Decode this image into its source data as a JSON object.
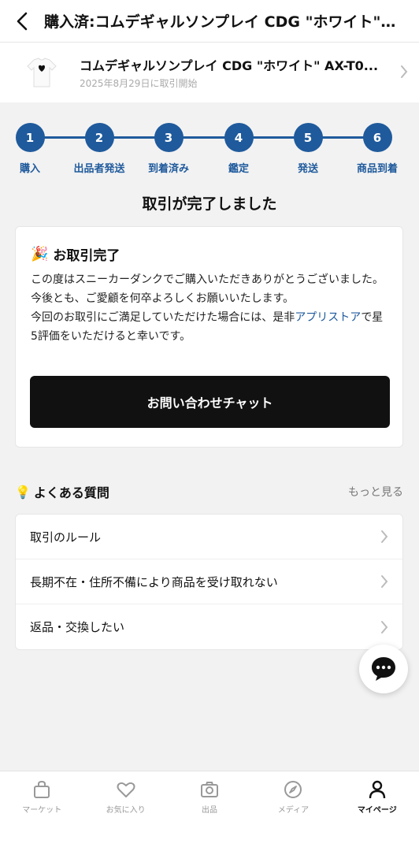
{
  "header": {
    "title": "購入済:コムデギャルソンプレイ CDG \"ホワイト\" AX-T0..."
  },
  "product": {
    "name": "コムデギャルソンプレイ CDG \"ホワイト\" AX-T0...",
    "sub": "2025年8月29日に取引開始"
  },
  "steps": [
    {
      "num": "1",
      "label": "購入"
    },
    {
      "num": "2",
      "label": "出品者発送"
    },
    {
      "num": "3",
      "label": "到着済み"
    },
    {
      "num": "4",
      "label": "鑑定"
    },
    {
      "num": "5",
      "label": "発送"
    },
    {
      "num": "6",
      "label": "商品到着"
    }
  ],
  "status_title": "取引が完了しました",
  "card": {
    "title": "お取引完了",
    "line1": "この度はスニーカーダンクでご購入いただきありがとうございました。",
    "line2": "今後とも、ご愛顧を何卒よろしくお願いいたします。",
    "line3_pre": "今回のお取引にご満足していただけた場合には、是非",
    "line3_link": "アプリストア",
    "line3_post": "で星5評価をいただけると幸いです。",
    "button": "お問い合わせチャット"
  },
  "faq": {
    "title": "よくある質問",
    "more": "もっと見る",
    "items": [
      "取引のルール",
      "長期不在・住所不備により商品を受け取れない",
      "返品・交換したい"
    ]
  },
  "nav": {
    "items": [
      {
        "label": "マーケット",
        "icon": "bag-icon"
      },
      {
        "label": "お気に入り",
        "icon": "heart-icon"
      },
      {
        "label": "出品",
        "icon": "camera-icon"
      },
      {
        "label": "メディア",
        "icon": "compass-icon"
      },
      {
        "label": "マイページ",
        "icon": "person-icon"
      }
    ],
    "active": "マイページ"
  },
  "colors": {
    "accent": "#1f5a9c",
    "button": "#111111"
  }
}
